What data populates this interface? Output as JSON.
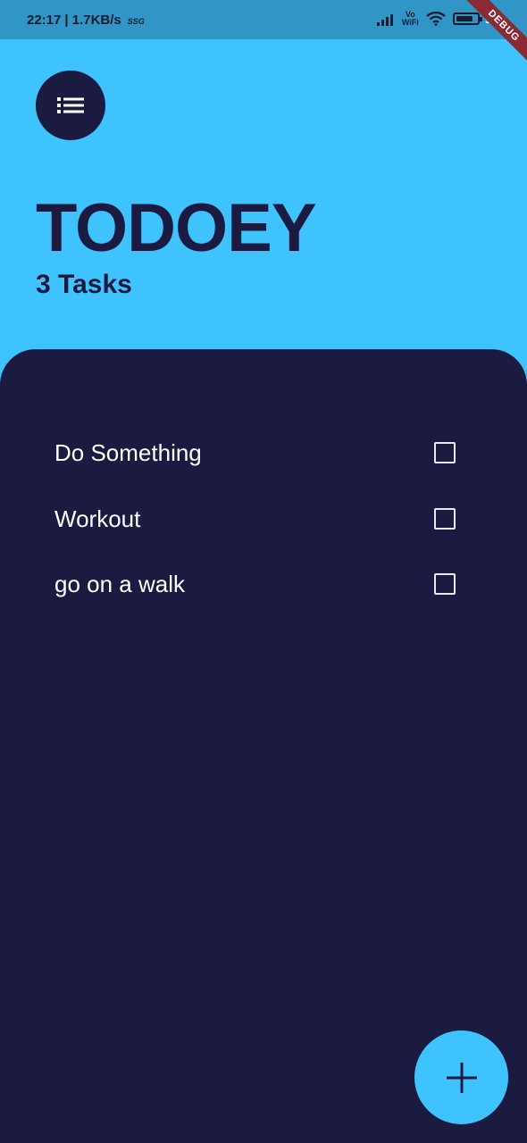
{
  "status_bar": {
    "time": "22:17",
    "network_speed": "| 1.7KB/s",
    "extra": "SSG",
    "vowifi": "Vo\nWiFi",
    "battery_percent": "9",
    "battery_level": 0.82
  },
  "debug_banner": "DEBUG",
  "header": {
    "menu_icon": "list-icon",
    "title": "TODOEY",
    "task_count": "3 Tasks"
  },
  "tasks": [
    {
      "label": "Do Something",
      "checked": false
    },
    {
      "label": "Workout",
      "checked": false
    },
    {
      "label": "go on a walk",
      "checked": false
    }
  ],
  "fab": {
    "icon": "plus-icon"
  },
  "colors": {
    "primary_light": "#3fc3fe",
    "primary_dark": "#1b1b41",
    "status_bar": "#3196c6",
    "debug": "#8b2a35"
  }
}
